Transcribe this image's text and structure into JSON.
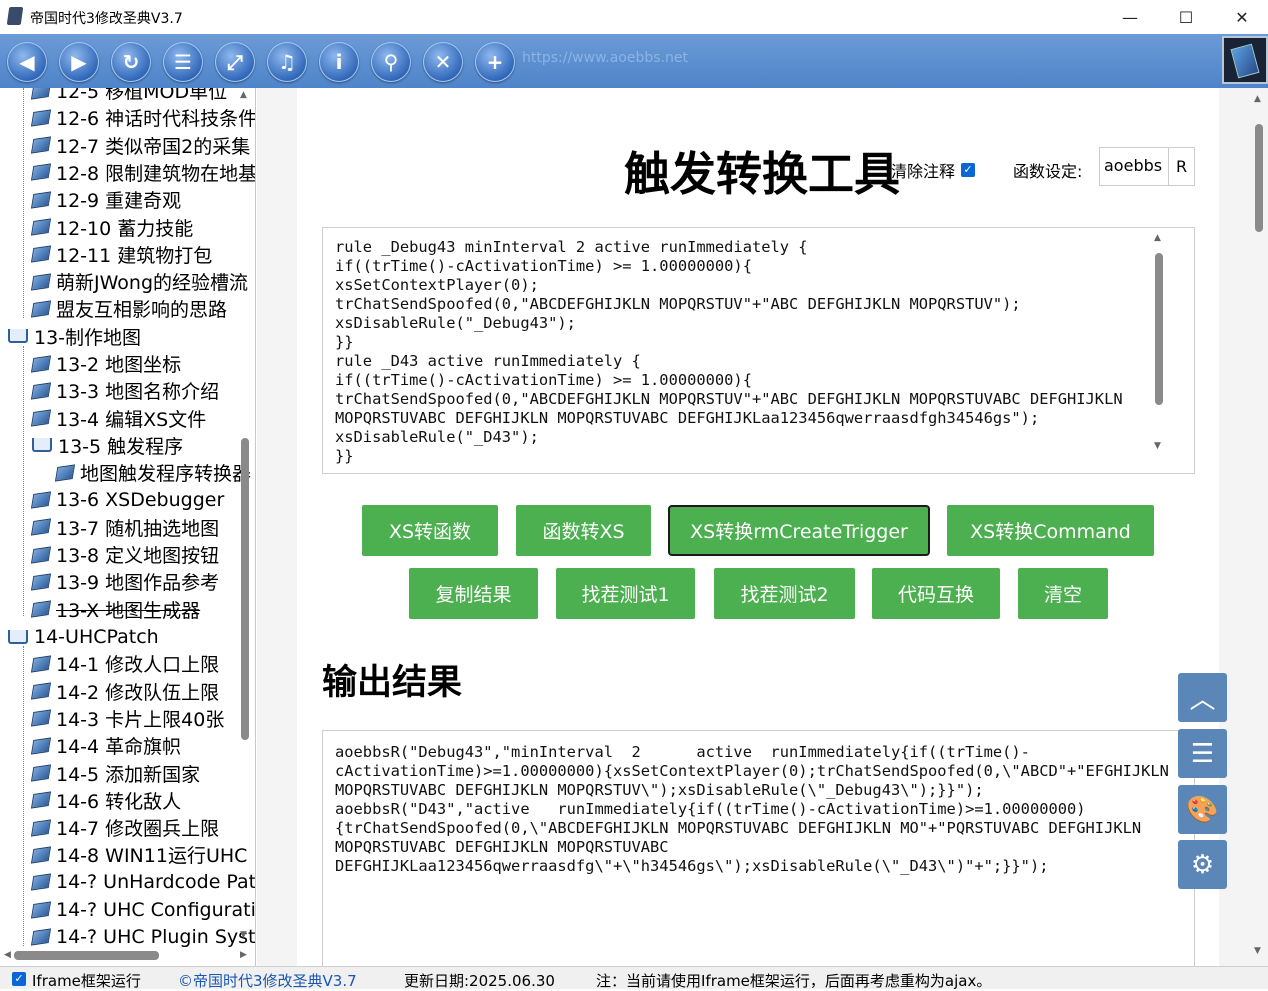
{
  "window": {
    "title": "帝国时代3修改圣典V3.7",
    "minimize": "—",
    "maximize": "☐",
    "close": "✕"
  },
  "toolbar": {
    "buttons": [
      {
        "name": "back",
        "glyph": "◀"
      },
      {
        "name": "forward",
        "glyph": "▶"
      },
      {
        "name": "refresh",
        "glyph": "↻"
      },
      {
        "name": "list",
        "glyph": "☰"
      },
      {
        "name": "fullscreen",
        "glyph": "⤢"
      },
      {
        "name": "music",
        "glyph": "♫"
      },
      {
        "name": "info",
        "glyph": "i"
      },
      {
        "name": "search",
        "glyph": "⚲"
      },
      {
        "name": "close",
        "glyph": "✕"
      },
      {
        "name": "add",
        "glyph": "+"
      }
    ],
    "url": "https://www.aoebbs.net"
  },
  "tree": {
    "items": [
      {
        "label": "12-5 移植MOD单位",
        "level": 1,
        "strike": false
      },
      {
        "label": "12-6 神话时代科技条件",
        "level": 1,
        "strike": false
      },
      {
        "label": "12-7 类似帝国2的采集",
        "level": 1,
        "strike": false
      },
      {
        "label": "12-8 限制建筑物在地基",
        "level": 1,
        "strike": false
      },
      {
        "label": "12-9 重建奇观",
        "level": 1,
        "strike": false
      },
      {
        "label": "12-10 蓄力技能",
        "level": 1,
        "strike": false
      },
      {
        "label": "12-11 建筑物打包",
        "level": 1,
        "strike": false
      },
      {
        "label": "萌新JWong的经验槽流",
        "level": 1,
        "strike": false
      },
      {
        "label": "盟友互相影响的思路",
        "level": 1,
        "strike": false
      },
      {
        "label": "13-制作地图",
        "level": 0,
        "strike": false
      },
      {
        "label": "13-2 地图坐标",
        "level": 1,
        "strike": false
      },
      {
        "label": "13-3 地图名称介绍",
        "level": 1,
        "strike": false
      },
      {
        "label": "13-4 编辑XS文件",
        "level": 1,
        "strike": false
      },
      {
        "label": "13-5 触发程序",
        "level": 1,
        "strike": false,
        "open": true
      },
      {
        "label": "地图触发程序转换器",
        "level": 2,
        "strike": false
      },
      {
        "label": "13-6 XSDebugger",
        "level": 1,
        "strike": false
      },
      {
        "label": "13-7 随机抽选地图",
        "level": 1,
        "strike": false
      },
      {
        "label": "13-8 定义地图按钮",
        "level": 1,
        "strike": false
      },
      {
        "label": "13-9 地图作品参考",
        "level": 1,
        "strike": false
      },
      {
        "label": "13-X 地图生成器",
        "level": 1,
        "strike": true
      },
      {
        "label": "14-UHCPatch",
        "level": 0,
        "strike": false
      },
      {
        "label": "14-1 修改人口上限",
        "level": 1,
        "strike": false
      },
      {
        "label": "14-2 修改队伍上限",
        "level": 1,
        "strike": false
      },
      {
        "label": "14-3 卡片上限40张",
        "level": 1,
        "strike": false
      },
      {
        "label": "14-4 革命旗帜",
        "level": 1,
        "strike": false
      },
      {
        "label": "14-5 添加新国家",
        "level": 1,
        "strike": false
      },
      {
        "label": "14-6 转化敌人",
        "level": 1,
        "strike": false
      },
      {
        "label": "14-7 修改圈兵上限",
        "level": 1,
        "strike": false
      },
      {
        "label": "14-8 WIN11运行UHC",
        "level": 1,
        "strike": false
      },
      {
        "label": "14-? UnHardcode Pat",
        "level": 1,
        "strike": false
      },
      {
        "label": "14-? UHC Configurati",
        "level": 1,
        "strike": false
      },
      {
        "label": "14-? UHC Plugin Syst",
        "level": 1,
        "strike": false
      }
    ]
  },
  "main": {
    "title": "触发转换工具",
    "remove_comments_label": "清除注释",
    "remove_comments_checked": true,
    "func_label": "函数设定:",
    "func_value": "aoebbs",
    "func_button": "R",
    "input_code": "rule _Debug43 minInterval 2 active runImmediately {\nif((trTime()-cActivationTime) >= 1.00000000){\nxsSetContextPlayer(0);\ntrChatSendSpoofed(0,\"ABCDEFGHIJKLN MOPQRSTUV\"+\"ABC DEFGHIJKLN MOPQRSTUV\");\nxsDisableRule(\"_Debug43\");\n}}\nrule _D43 active runImmediately {\nif((trTime()-cActivationTime) >= 1.00000000){\ntrChatSendSpoofed(0,\"ABCDEFGHIJKLN MOPQRSTUV\"+\"ABC DEFGHIJKLN MOPQRSTUVABC DEFGHIJKLN\nMOPQRSTUVABC DEFGHIJKLN MOPQRSTUVABC DEFGHIJKLaa123456qwerraasdfgh34546gs\");\nxsDisableRule(\"_D43\");\n}}",
    "buttons_row1": [
      "XS转函数",
      "函数转XS",
      "XS转换rmCreateTrigger",
      "XS转换Command"
    ],
    "buttons_row2": [
      "复制结果",
      "找茬测试1",
      "找茬测试2",
      "代码互换",
      "清空"
    ],
    "output_title": "输出结果",
    "output_code": "aoebbsR(\"Debug43\",\"minInterval  2      active  runImmediately{if((trTime()-\ncActivationTime)>=1.00000000){xsSetContextPlayer(0);trChatSendSpoofed(0,\\\"ABCD\"+\"EFGHIJKLN\nMOPQRSTUVABC DEFGHIJKLN MOPQRSTUV\\\");xsDisableRule(\\\"_Debug43\\\");}}\");\naoebbsR(\"D43\",\"active   runImmediately{if((trTime()-cActivationTime)>=1.00000000)\n{trChatSendSpoofed(0,\\\"ABCDEFGHIJKLN MOPQRSTUVABC DEFGHIJKLN MO\"+\"PQRSTUVABC DEFGHIJKLN\nMOPQRSTUVABC DEFGHIJKLN MOPQRSTUVABC\nDEFGHIJKLaa123456qwerraasdfg\\\"+\\\"h34546gs\\\");xsDisableRule(\\\"_D43\\\")\"+\";}}\");"
  },
  "side_buttons": [
    {
      "name": "back-to-top",
      "glyph": "︿"
    },
    {
      "name": "menu",
      "glyph": "☰"
    },
    {
      "name": "palette",
      "glyph": "🎨"
    },
    {
      "name": "settings",
      "glyph": "⚙"
    }
  ],
  "status": {
    "iframe_label": "Iframe框架运行",
    "iframe_checked": true,
    "app_link": "©帝国时代3修改圣典V3.7",
    "update_date": "更新日期:2025.06.30",
    "note": "注：当前请使用Iframe框架运行，后面再考虑重构为ajax。"
  },
  "colors": {
    "accent_green": "#4caf50",
    "toolbar_blue": "#4e84c9",
    "side_button_blue": "#5b86b8",
    "checkbox_blue": "#0a66d6"
  }
}
